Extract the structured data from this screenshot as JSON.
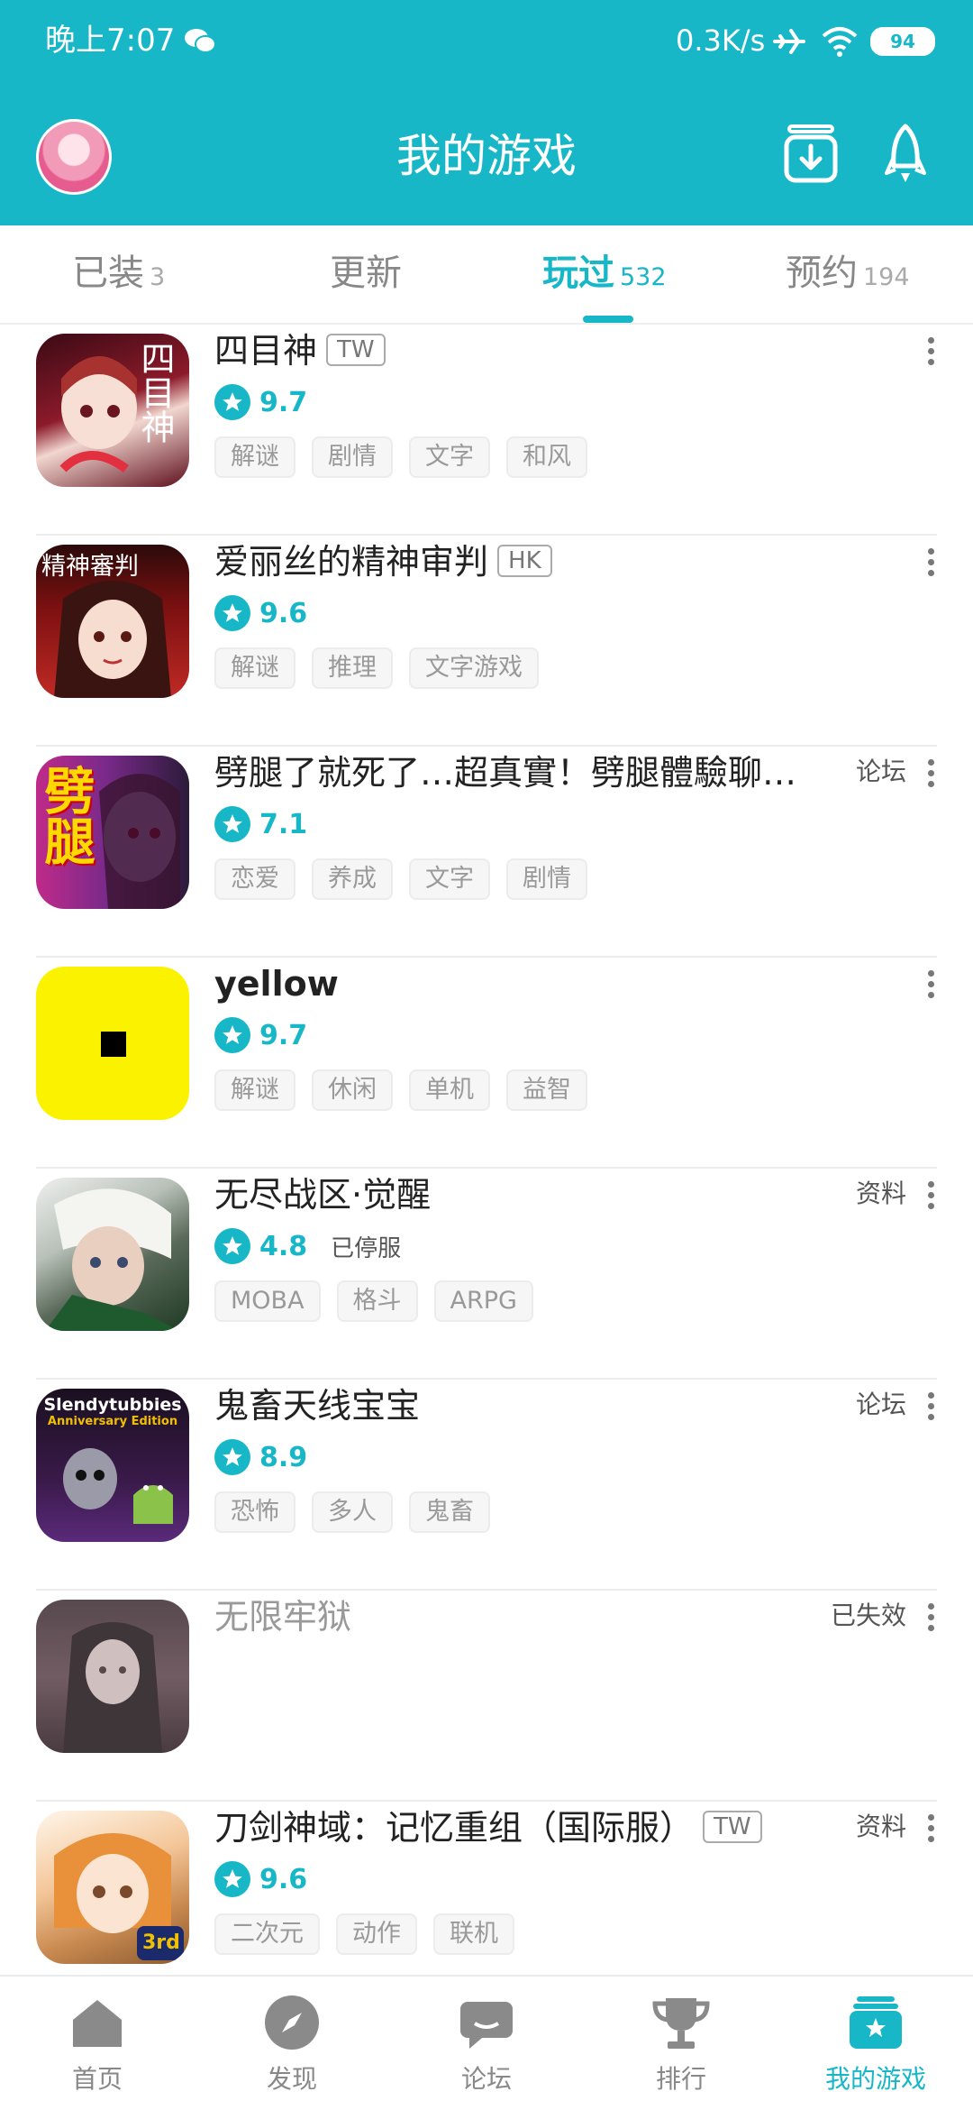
{
  "status": {
    "time": "晚上7:07",
    "speed": "0.3K/s",
    "battery": "94"
  },
  "appbar": {
    "title": "我的游戏"
  },
  "tabs": [
    {
      "label": "已装",
      "count": "3"
    },
    {
      "label": "更新",
      "count": ""
    },
    {
      "label": "玩过",
      "count": "532"
    },
    {
      "label": "预约",
      "count": "194"
    }
  ],
  "games": [
    {
      "name": "四目神",
      "region": "TW",
      "score": "9.7",
      "tags": [
        "解谜",
        "剧情",
        "文字",
        "和风"
      ],
      "icon_text": "四目神"
    },
    {
      "name": "爱丽丝的精神审判",
      "region": "HK",
      "score": "9.6",
      "tags": [
        "解谜",
        "推理",
        "文字游戏"
      ],
      "icon_text": "精神審判"
    },
    {
      "name": "劈腿了就死了…超真實！劈腿體驗聊…",
      "link": "论坛",
      "score": "7.1",
      "tags": [
        "恋爱",
        "养成",
        "文字",
        "剧情"
      ],
      "icon_text": "劈腿"
    },
    {
      "name": "yellow",
      "score": "9.7",
      "tags": [
        "解谜",
        "休闲",
        "单机",
        "益智"
      ]
    },
    {
      "name": "无尽战区·觉醒",
      "link": "资料",
      "score": "4.8",
      "status": "已停服",
      "tags": [
        "MOBA",
        "格斗",
        "ARPG"
      ]
    },
    {
      "name": "鬼畜天线宝宝",
      "link": "论坛",
      "score": "8.9",
      "tags": [
        "恐怖",
        "多人",
        "鬼畜"
      ],
      "icon_text": "Slendytubbies",
      "icon_subtext": "Anniversary Edition"
    },
    {
      "name": "无限牢狱",
      "link": "已失效"
    },
    {
      "name": "刀剑神域：记忆重组（国际服）",
      "region": "TW",
      "link": "资料",
      "score": "9.6",
      "tags": [
        "二次元",
        "动作",
        "联机"
      ],
      "icon_text": "3rd"
    }
  ],
  "bottom_nav": [
    {
      "label": "首页",
      "icon": "home-icon"
    },
    {
      "label": "发现",
      "icon": "compass-icon"
    },
    {
      "label": "论坛",
      "icon": "chat-icon"
    },
    {
      "label": "排行",
      "icon": "trophy-icon"
    },
    {
      "label": "我的游戏",
      "icon": "my-games-icon",
      "active": true
    }
  ],
  "colors": {
    "accent": "#17b7c8"
  }
}
